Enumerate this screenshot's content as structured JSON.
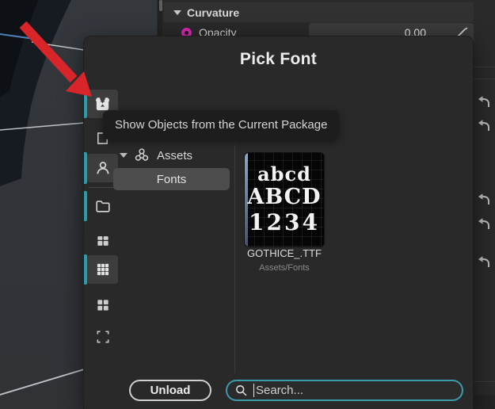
{
  "details_panel": {
    "section_header": "Curvature",
    "property": {
      "label": "Opacity",
      "value": "0.00"
    }
  },
  "dialog": {
    "title": "Pick Font",
    "tooltip": "Show Objects from the Current Package",
    "sidebar_icons": [
      "package",
      "clipboard",
      "person",
      "folder",
      "grid-small",
      "grid-dense",
      "grid-large",
      "expand"
    ],
    "tree": {
      "root_label": "Assets",
      "child_label": "Fonts"
    },
    "asset": {
      "filename": "GOTHICE_.TTF",
      "path": "Assets/Fonts",
      "preview_lines": [
        "abcd",
        "ABCD",
        "1234"
      ]
    },
    "footer": {
      "unload_label": "Unload",
      "search_placeholder": "Search..."
    }
  },
  "colors": {
    "accent_teal": "#3a9cab",
    "arrow_red": "#d8252a",
    "opacity_dot": "#d627b0",
    "selection_blue": "#8fa7c4"
  }
}
